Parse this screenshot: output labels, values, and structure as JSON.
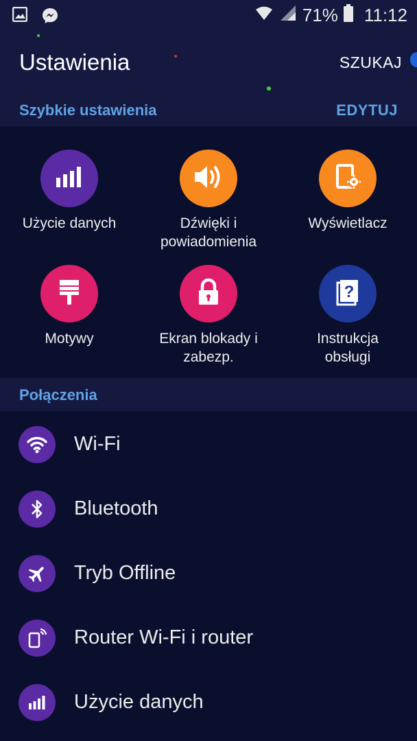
{
  "status_bar": {
    "battery": "71%",
    "time": "11:12",
    "icons": [
      "gallery-icon",
      "messenger-icon",
      "wifi-icon",
      "signal-icon",
      "battery-icon"
    ]
  },
  "header": {
    "title": "Ustawienia",
    "search_label": "SZUKAJ"
  },
  "quick_settings": {
    "title": "Szybkie ustawienia",
    "edit_label": "EDYTUJ",
    "tiles": [
      {
        "label": "Użycie danych",
        "color": "#5b2aa5",
        "icon": "data-usage-icon"
      },
      {
        "label": "Dźwięki i\npowiadomienia",
        "color": "#f7891f",
        "icon": "volume-icon"
      },
      {
        "label": "Wyświetlacz",
        "color": "#f7891f",
        "icon": "display-icon"
      },
      {
        "label": "Motywy",
        "color": "#e01f6b",
        "icon": "paint-brush-icon"
      },
      {
        "label": "Ekran blokady i\nzabezp.",
        "color": "#e01f6b",
        "icon": "lock-icon"
      },
      {
        "label": "Instrukcja\nobsługi",
        "color": "#1e3a9c",
        "icon": "help-book-icon"
      }
    ]
  },
  "connections": {
    "title": "Połączenia",
    "items": [
      {
        "label": "Wi-Fi",
        "icon": "wifi-icon"
      },
      {
        "label": "Bluetooth",
        "icon": "bluetooth-icon"
      },
      {
        "label": "Tryb Offline",
        "icon": "airplane-icon"
      },
      {
        "label": "Router Wi-Fi i router",
        "icon": "hotspot-icon"
      },
      {
        "label": "Użycie danych",
        "icon": "data-usage-icon"
      }
    ]
  }
}
